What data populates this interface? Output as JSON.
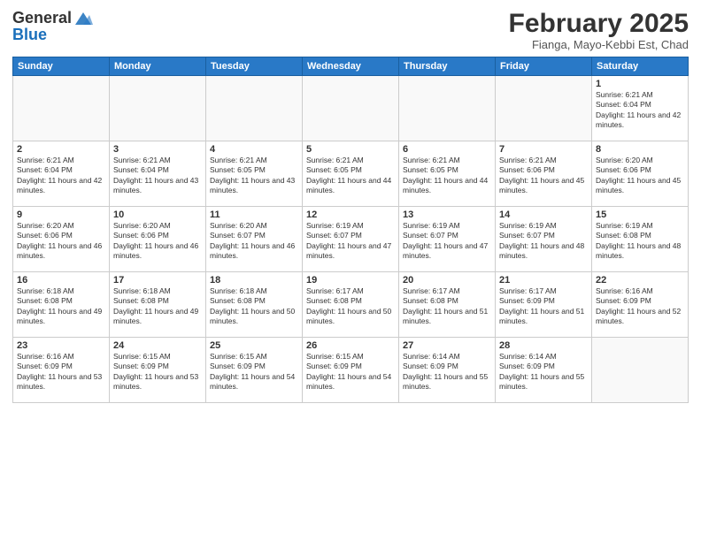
{
  "header": {
    "logo_general": "General",
    "logo_blue": "Blue",
    "month_title": "February 2025",
    "location": "Fianga, Mayo-Kebbi Est, Chad"
  },
  "days_of_week": [
    "Sunday",
    "Monday",
    "Tuesday",
    "Wednesday",
    "Thursday",
    "Friday",
    "Saturday"
  ],
  "weeks": [
    [
      {
        "day": "",
        "info": ""
      },
      {
        "day": "",
        "info": ""
      },
      {
        "day": "",
        "info": ""
      },
      {
        "day": "",
        "info": ""
      },
      {
        "day": "",
        "info": ""
      },
      {
        "day": "",
        "info": ""
      },
      {
        "day": "1",
        "info": "Sunrise: 6:21 AM\nSunset: 6:04 PM\nDaylight: 11 hours and 42 minutes."
      }
    ],
    [
      {
        "day": "2",
        "info": "Sunrise: 6:21 AM\nSunset: 6:04 PM\nDaylight: 11 hours and 42 minutes."
      },
      {
        "day": "3",
        "info": "Sunrise: 6:21 AM\nSunset: 6:04 PM\nDaylight: 11 hours and 43 minutes."
      },
      {
        "day": "4",
        "info": "Sunrise: 6:21 AM\nSunset: 6:05 PM\nDaylight: 11 hours and 43 minutes."
      },
      {
        "day": "5",
        "info": "Sunrise: 6:21 AM\nSunset: 6:05 PM\nDaylight: 11 hours and 44 minutes."
      },
      {
        "day": "6",
        "info": "Sunrise: 6:21 AM\nSunset: 6:05 PM\nDaylight: 11 hours and 44 minutes."
      },
      {
        "day": "7",
        "info": "Sunrise: 6:21 AM\nSunset: 6:06 PM\nDaylight: 11 hours and 45 minutes."
      },
      {
        "day": "8",
        "info": "Sunrise: 6:20 AM\nSunset: 6:06 PM\nDaylight: 11 hours and 45 minutes."
      }
    ],
    [
      {
        "day": "9",
        "info": "Sunrise: 6:20 AM\nSunset: 6:06 PM\nDaylight: 11 hours and 46 minutes."
      },
      {
        "day": "10",
        "info": "Sunrise: 6:20 AM\nSunset: 6:06 PM\nDaylight: 11 hours and 46 minutes."
      },
      {
        "day": "11",
        "info": "Sunrise: 6:20 AM\nSunset: 6:07 PM\nDaylight: 11 hours and 46 minutes."
      },
      {
        "day": "12",
        "info": "Sunrise: 6:19 AM\nSunset: 6:07 PM\nDaylight: 11 hours and 47 minutes."
      },
      {
        "day": "13",
        "info": "Sunrise: 6:19 AM\nSunset: 6:07 PM\nDaylight: 11 hours and 47 minutes."
      },
      {
        "day": "14",
        "info": "Sunrise: 6:19 AM\nSunset: 6:07 PM\nDaylight: 11 hours and 48 minutes."
      },
      {
        "day": "15",
        "info": "Sunrise: 6:19 AM\nSunset: 6:08 PM\nDaylight: 11 hours and 48 minutes."
      }
    ],
    [
      {
        "day": "16",
        "info": "Sunrise: 6:18 AM\nSunset: 6:08 PM\nDaylight: 11 hours and 49 minutes."
      },
      {
        "day": "17",
        "info": "Sunrise: 6:18 AM\nSunset: 6:08 PM\nDaylight: 11 hours and 49 minutes."
      },
      {
        "day": "18",
        "info": "Sunrise: 6:18 AM\nSunset: 6:08 PM\nDaylight: 11 hours and 50 minutes."
      },
      {
        "day": "19",
        "info": "Sunrise: 6:17 AM\nSunset: 6:08 PM\nDaylight: 11 hours and 50 minutes."
      },
      {
        "day": "20",
        "info": "Sunrise: 6:17 AM\nSunset: 6:08 PM\nDaylight: 11 hours and 51 minutes."
      },
      {
        "day": "21",
        "info": "Sunrise: 6:17 AM\nSunset: 6:09 PM\nDaylight: 11 hours and 51 minutes."
      },
      {
        "day": "22",
        "info": "Sunrise: 6:16 AM\nSunset: 6:09 PM\nDaylight: 11 hours and 52 minutes."
      }
    ],
    [
      {
        "day": "23",
        "info": "Sunrise: 6:16 AM\nSunset: 6:09 PM\nDaylight: 11 hours and 53 minutes."
      },
      {
        "day": "24",
        "info": "Sunrise: 6:15 AM\nSunset: 6:09 PM\nDaylight: 11 hours and 53 minutes."
      },
      {
        "day": "25",
        "info": "Sunrise: 6:15 AM\nSunset: 6:09 PM\nDaylight: 11 hours and 54 minutes."
      },
      {
        "day": "26",
        "info": "Sunrise: 6:15 AM\nSunset: 6:09 PM\nDaylight: 11 hours and 54 minutes."
      },
      {
        "day": "27",
        "info": "Sunrise: 6:14 AM\nSunset: 6:09 PM\nDaylight: 11 hours and 55 minutes."
      },
      {
        "day": "28",
        "info": "Sunrise: 6:14 AM\nSunset: 6:09 PM\nDaylight: 11 hours and 55 minutes."
      },
      {
        "day": "",
        "info": ""
      }
    ]
  ]
}
